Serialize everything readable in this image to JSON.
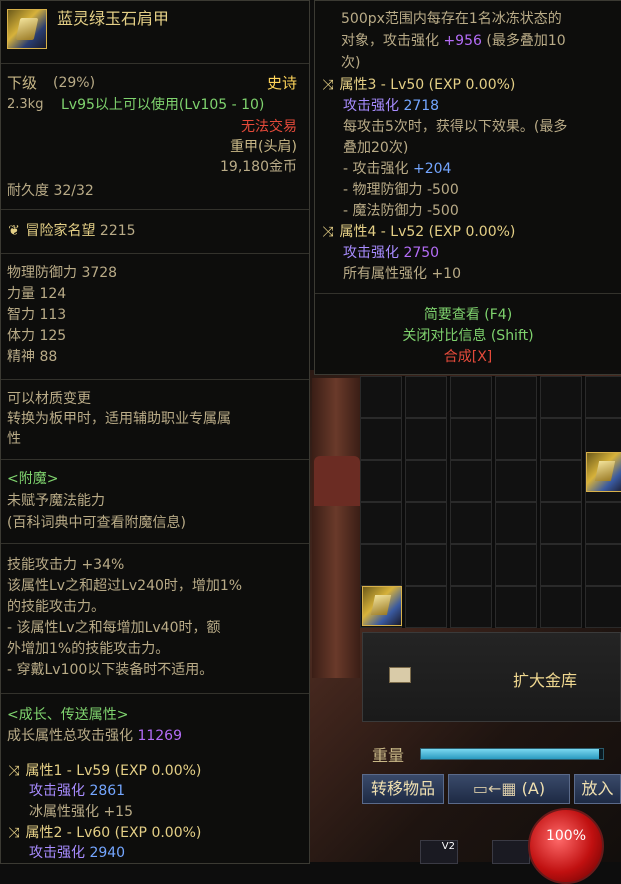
{
  "item": {
    "name": "蓝灵绿玉石肩甲",
    "grade": "下级",
    "grade_pct": "(29%)",
    "rarity": "史诗",
    "weight": "2.3kg",
    "level_req": "Lv95以上可以使用(Lv105 - 10)",
    "trade": "无法交易",
    "slot_type": "重甲(头肩)",
    "price": "19,180金币",
    "durability": "耐久度 32/32",
    "reputation_label": "冒险家名望",
    "reputation_value": "2215",
    "stats": [
      {
        "label": "物理防御力",
        "value": "3728"
      },
      {
        "label": "力量",
        "value": "124"
      },
      {
        "label": "智力",
        "value": "113"
      },
      {
        "label": "体力",
        "value": "125"
      },
      {
        "label": "精神",
        "value": "88"
      }
    ],
    "material_change": "可以材质变更",
    "convert_note_1": "转换为板甲时，适用辅助职业专属属",
    "convert_note_2": "性",
    "enchant_title": "<附魔>",
    "enchant_none": "未赋予魔法能力",
    "enchant_hint": "(百科词典中可查看附魔信息)",
    "skill_lines": [
      "技能攻击力 +34%",
      "该属性Lv之和超过Lv240时，增加1%",
      "的技能攻击力。",
      "- 该属性Lv之和每增加Lv40时，额",
      "外增加1%的技能攻击力。",
      "- 穿戴Lv100以下装备时不适用。"
    ],
    "growth_title": "<成长、传送属性>",
    "growth_total_label": "成长属性总攻击强化",
    "growth_total_value": "11269",
    "attr1_title": "属性1 - Lv59 (EXP 0.00%)",
    "attr1_atk_label": "攻击强化",
    "attr1_atk_value": "2861",
    "attr1_ice_label": "冰属性强化",
    "attr1_ice_value": "+15",
    "attr2_title": "属性2 - Lv60 (EXP 0.00%)",
    "attr2_atk_label": "攻击强化",
    "attr2_atk_value": "2940"
  },
  "right_tip": {
    "top_line_1": "500px范围内每存在1名冰冻状态的",
    "top_line_2_pre": "对象，攻击强化",
    "top_line_2_val": "+956",
    "top_line_2_post": "(最多叠加10",
    "top_line_3": "次)",
    "attr3_title": "属性3 - Lv50 (EXP 0.00%)",
    "attr3_atk_label": "攻击强化",
    "attr3_atk_value": "2718",
    "attr3_effect_1": "每攻击5次时，获得以下效果。(最多",
    "attr3_effect_2": "叠加20次)",
    "attr3_sub_1_label": "- 攻击强化",
    "attr3_sub_1_value": "+204",
    "attr3_sub_2": "- 物理防御力 -500",
    "attr3_sub_3": "- 魔法防御力 -500",
    "attr4_title": "属性4 - Lv52 (EXP 0.00%)",
    "attr4_atk_label": "攻击强化",
    "attr4_atk_value": "2750",
    "attr4_all": "所有属性强化 +10",
    "brief_view": "简要查看 (F4)",
    "close_compare": "关闭对比信息 (Shift)",
    "synthesize": "合成[X]"
  },
  "inventory": {
    "expand_label": "扩大金库",
    "weight_label": "重量",
    "weight_fill": 0.98,
    "transfer_button": "转移物品",
    "auto_button": "(A)",
    "place_button": "放入",
    "hp_percent": "100%",
    "skill_level_badge": "V2"
  },
  "colors": {
    "gold": "#e4cf86",
    "purple": "#b36cf6",
    "blue": "#74a6ff",
    "green": "#7fd36e",
    "red": "#e44a3a"
  }
}
